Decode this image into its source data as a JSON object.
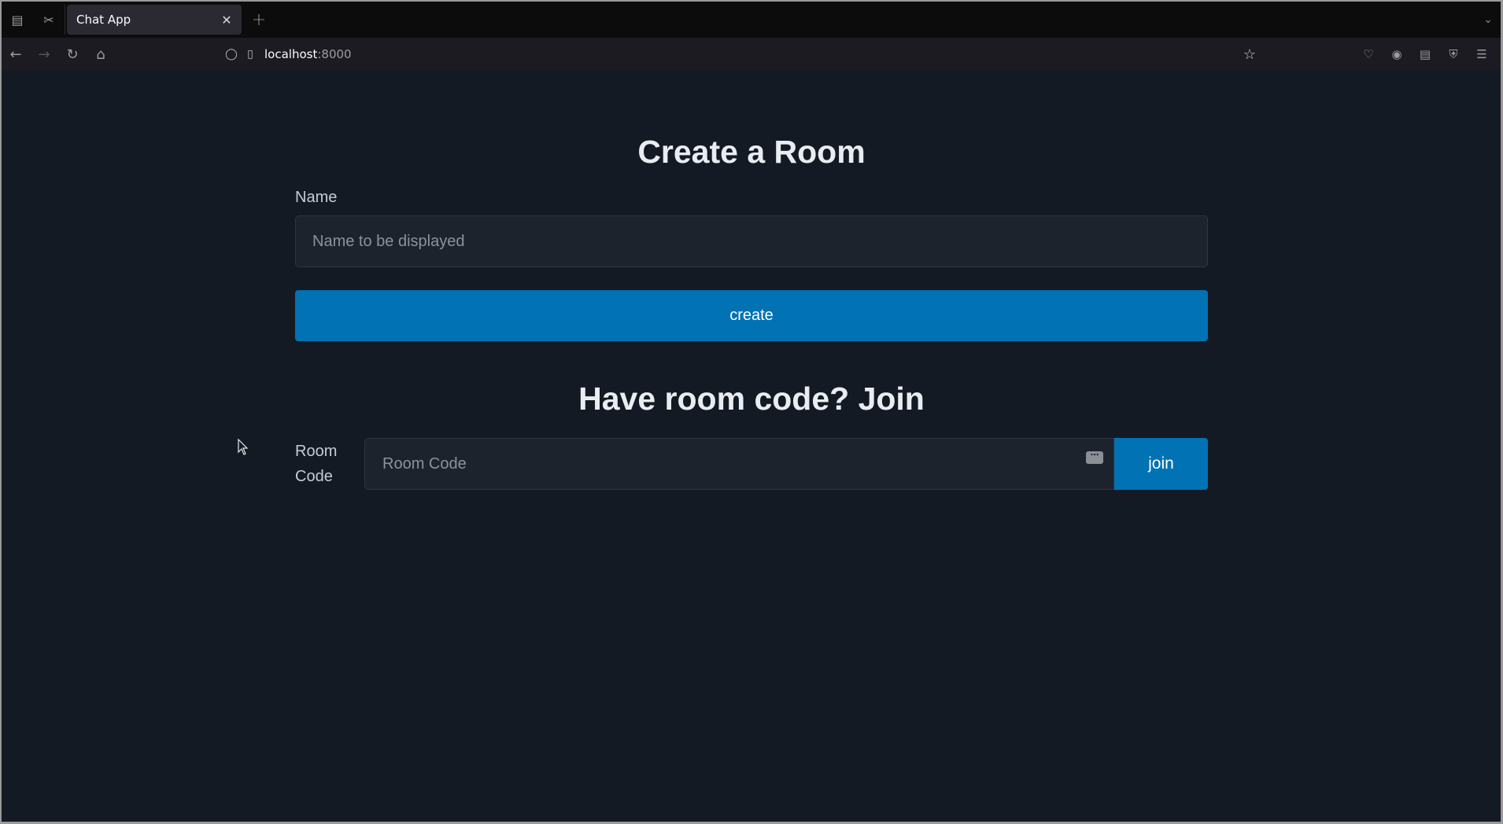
{
  "browser": {
    "tab_title": "Chat App",
    "url_host": "localhost",
    "url_port": ":8000"
  },
  "create_section": {
    "title": "Create a Room",
    "name_label": "Name",
    "name_placeholder": "Name to be displayed",
    "create_button": "create"
  },
  "join_section": {
    "title": "Have room code? Join",
    "code_label": "Room Code",
    "code_placeholder": "Room Code",
    "join_button": "join"
  },
  "colors": {
    "page_background": "#141a23",
    "accent": "#0172b3",
    "input_background": "#1d232d"
  }
}
